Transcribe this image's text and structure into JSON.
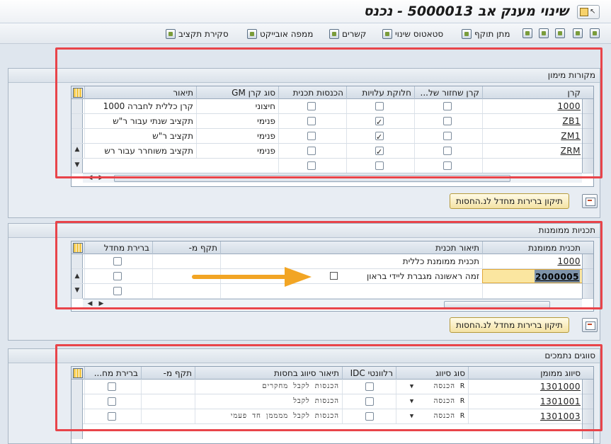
{
  "window": {
    "title": "שינוי מענק אב 5000013 - נכנס"
  },
  "toolbar": {
    "items": [
      {
        "label": "סקירת תקציב",
        "icon": "budget-overview-icon"
      },
      {
        "label": "ממפה אובייקט",
        "icon": "object-mapper-icon"
      },
      {
        "label": "קשרים",
        "icon": "relationships-icon"
      },
      {
        "label": "סטאטוס שינוי",
        "icon": "status-change-icon"
      },
      {
        "label": "מתן תוקף",
        "icon": "validate-icon"
      }
    ]
  },
  "sources": {
    "title": "מקורות מימון",
    "columns": [
      "קרן",
      "קרן שחזור של...",
      "חלוקת עלויות",
      "הכנסות תכנית",
      "סוג קרן GM",
      "תיאור"
    ],
    "rows": [
      {
        "fund": "1000",
        "recovery": false,
        "cost_share": false,
        "program_income": false,
        "type": "חיצוני",
        "desc": "קרן כללית לחברה 1000"
      },
      {
        "fund": "ZB1",
        "recovery": false,
        "cost_share": true,
        "program_income": false,
        "type": "פנימי",
        "desc": "תקציב שנתי עבור ר\"ש"
      },
      {
        "fund": "ZM1",
        "recovery": false,
        "cost_share": true,
        "program_income": false,
        "type": "פנימי",
        "desc": "תקציב ר\"ש"
      },
      {
        "fund": "ZRM",
        "recovery": false,
        "cost_share": true,
        "program_income": false,
        "type": "פנימי",
        "desc": "תקציב משוחרר עבור רש"
      }
    ],
    "fix_button": "תיקון ברירות מחדל לנ.החסות"
  },
  "programs": {
    "title": "תכניות ממומנות",
    "columns": [
      "תכנית ממומנת",
      "תיאור תכנית",
      "תקף מ-",
      "ברירת מחדל"
    ],
    "rows": [
      {
        "program": "1000",
        "desc": "תכנית ממומנת כללית",
        "valid_from": "",
        "default": false
      },
      {
        "program": "2000005",
        "desc": "זמה ראשונה מגברת ליידי בראון",
        "valid_from": "",
        "default": false
      }
    ],
    "fix_button": "תיקון ברירות מחדל לנ.החסות"
  },
  "classes": {
    "title": "סווגים נתמכים",
    "columns": [
      "סיווג ממומן",
      "סוג סיווג",
      "רלוונטי IDC",
      "תיאור סיווג בחסות",
      "תקף מ-",
      "ברירת מח..."
    ],
    "rows": [
      {
        "class": "1301000",
        "type": "R הכנסה",
        "idc": false,
        "desc": "הכנסות לקבל מחקרים",
        "valid_from": "",
        "default": false
      },
      {
        "class": "1301001",
        "type": "R הכנסה",
        "idc": false,
        "desc": "הכנסות לקבל",
        "valid_from": "",
        "default": false
      },
      {
        "class": "1301003",
        "type": "R הכנסה",
        "idc": false,
        "desc": "הכנסות לקבל ממממן חד פעמי",
        "valid_from": "",
        "default": false
      }
    ]
  },
  "colors": {
    "highlight_border": "#e8444a",
    "annotation_arrow": "#f2a524",
    "selected_cell": "#fbe6a0"
  }
}
